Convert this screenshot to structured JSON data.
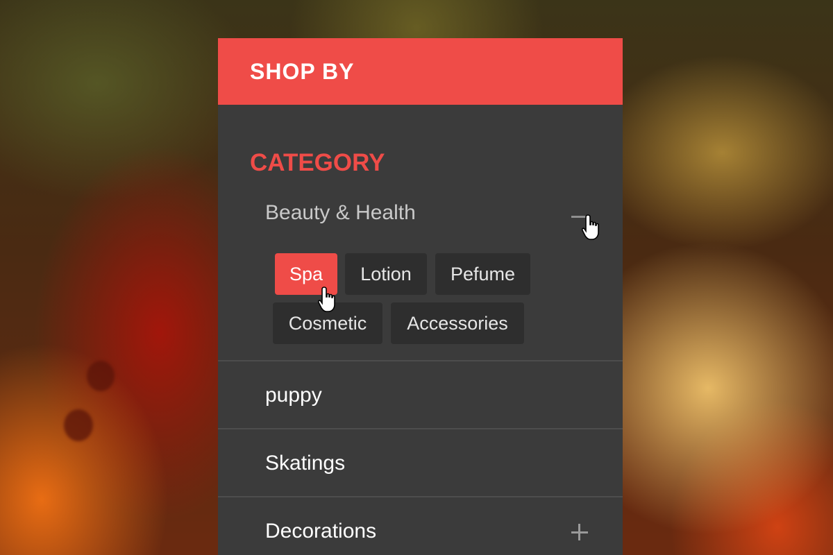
{
  "panel": {
    "title": "SHOP BY",
    "accent_color": "#ef4c48",
    "background_color": "#3b3b3b"
  },
  "category": {
    "heading": "CATEGORY",
    "items": [
      {
        "label": "Beauty & Health",
        "state": "expanded",
        "toggle_icon": "minus-icon",
        "tags": [
          {
            "label": "Spa",
            "active": true
          },
          {
            "label": "Lotion",
            "active": false
          },
          {
            "label": "Pefume",
            "active": false
          },
          {
            "label": "Cosmetic",
            "active": false
          },
          {
            "label": "Accessories",
            "active": false
          }
        ]
      },
      {
        "label": "puppy"
      },
      {
        "label": "Skatings"
      },
      {
        "label": "Decorations",
        "state": "collapsed",
        "toggle_icon": "plus-icon"
      }
    ]
  },
  "cursors": [
    "hand-pointer-icon",
    "hand-pointer-icon"
  ]
}
